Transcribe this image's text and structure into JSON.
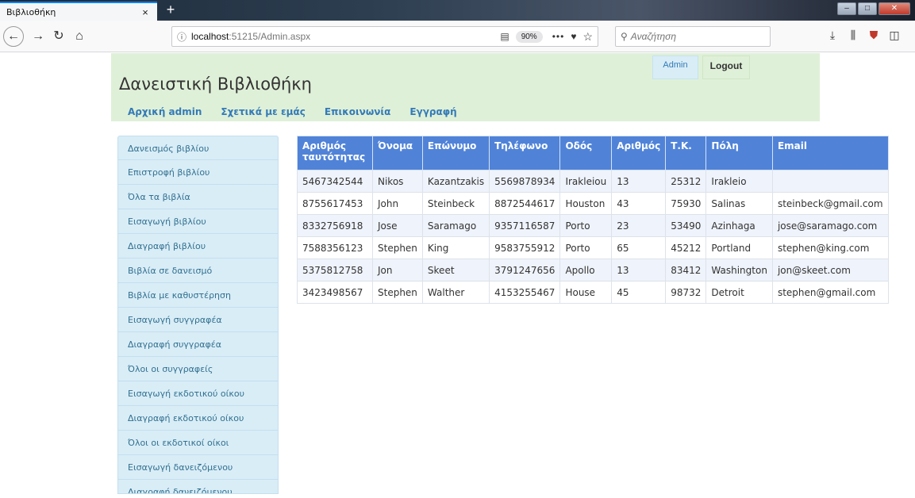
{
  "browser": {
    "tab_title": "Βιβλιοθήκη",
    "tab_close": "×",
    "new_tab": "+",
    "url_host": "localhost",
    "url_rest": ":51215/Admin.aspx",
    "zoom": "90%",
    "more": "•••",
    "search_placeholder": "Αναζήτηση"
  },
  "header": {
    "title": "Δανειστική Βιβλιοθήκη",
    "admin_label": "Admin",
    "logout_label": "Logout",
    "nav": [
      "Αρχική admin",
      "Σχετικά με εμάς",
      "Επικοινωνία",
      "Εγγραφή"
    ]
  },
  "sidebar": {
    "items": [
      "Δανεισμός βιβλίου",
      "Επιστροφή βιβλίου",
      "Όλα τα βιβλία",
      "Εισαγωγή βιβλίου",
      "Διαγραφή βιβλίου",
      "Βιβλία σε δανεισμό",
      "Βιβλία με καθυστέρηση",
      "Εισαγωγή συγγραφέα",
      "Διαγραφή συγγραφέα",
      "Όλοι οι συγγραφείς",
      "Εισαγωγή εκδοτικού οίκου",
      "Διαγραφή εκδοτικού οίκου",
      "Όλοι οι εκδοτικοί οίκοι",
      "Εισαγωγή δανειζόμενου",
      "Διαγραφή δανειζόμενου"
    ]
  },
  "table": {
    "columns": [
      "Αριθμός ταυτότητας",
      "Όνομα",
      "Επώνυμο",
      "Τηλέφωνο",
      "Οδός",
      "Αριθμός",
      "Τ.Κ.",
      "Πόλη",
      "Email"
    ],
    "rows": [
      [
        "5467342544",
        "Nikos",
        "Kazantzakis",
        "5569878934",
        "Irakleiou",
        "13",
        "25312",
        "Irakleio",
        ""
      ],
      [
        "8755617453",
        "John",
        "Steinbeck",
        "8872544617",
        "Houston",
        "43",
        "75930",
        "Salinas",
        "steinbeck@gmail.com"
      ],
      [
        "8332756918",
        "Jose",
        "Saramago",
        "9357116587",
        "Porto",
        "23",
        "53490",
        "Azinhaga",
        "jose@saramago.com"
      ],
      [
        "7588356123",
        "Stephen",
        "King",
        "9583755912",
        "Porto",
        "65",
        "45212",
        "Portland",
        "stephen@king.com"
      ],
      [
        "5375812758",
        "Jon",
        "Skeet",
        "3791247656",
        "Apollo",
        "13",
        "83412",
        "Washington",
        "jon@skeet.com"
      ],
      [
        "3423498567",
        "Stephen",
        "Walther",
        "4153255467",
        "House",
        "45",
        "98732",
        "Detroit",
        "stephen@gmail.com"
      ]
    ]
  },
  "colors": {
    "header_bg": "#dff0d8",
    "sidebar_bg": "#d9edf7",
    "table_header_bg": "#5083d8",
    "link": "#337ab7"
  }
}
